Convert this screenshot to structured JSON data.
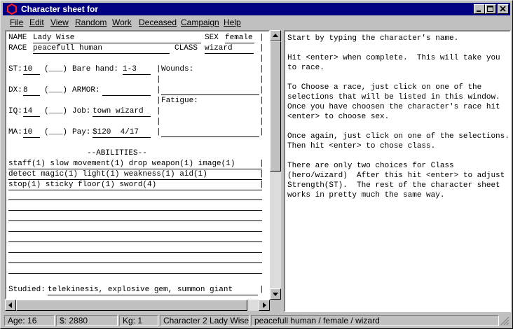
{
  "window": {
    "title": "Character sheet for"
  },
  "menu": [
    "File",
    "Edit",
    "View",
    "Random",
    "Work",
    "Deceased",
    "Campaign",
    "Help"
  ],
  "sheet": {
    "name_label": "NAME",
    "name_value": "Lady Wise",
    "sex_label": "SEX",
    "sex_value": "female",
    "race_label": "RACE",
    "race_value": "peacefull human",
    "class_label": "CLASS",
    "class_value": "wizard",
    "st_label": "ST:",
    "st_value": "10",
    "dx_label": "DX:",
    "dx_value": "8",
    "iq_label": "IQ:",
    "iq_value": "14",
    "ma_label": "MA:",
    "ma_value": "10",
    "bare_hand_label": "Bare hand:",
    "bare_hand_value": "1-3",
    "armor_label": "ARMOR:",
    "armor_value": "",
    "job_label": "Job:",
    "job_value": "town wizard",
    "pay_label": "Pay:",
    "pay_value": "$120  4/17",
    "wounds_label": "Wounds:",
    "fatigue_label": "Fatigue:",
    "abilities_header": "--ABILITIES--",
    "abilities": [
      "staff(1) slow movement(1) drop weapon(1) image(1)",
      "detect magic(1) light(1) weakness(1) aid(1)",
      "stop(1) sticky floor(1) sword(4)"
    ],
    "studied_label": "Studied:",
    "studied_value": "telekinesis, explosive gem, summon giant"
  },
  "help_text": "Start by typing the character's name.\n\nHit <enter> when complete.  This will take you to race.\n\nTo Choose a race, just click on one of the selections that will be listed in this window.  Once you have choosen the character's race hit <enter> to choose sex.\n\nOnce again, just click on one of the selections.  Then hit <enter> to chose class.\n\nThere are only two choices for Class (hero/wizard)  After this hit <enter> to adjust Strength(ST).  The rest of the character sheet works in pretty much the same way.",
  "status": {
    "age": "Age:  16",
    "money": "$: 2880",
    "kg": "Kg: 1",
    "character": "Character 2 Lady Wise",
    "summary": "peacefull human / female / wizard"
  },
  "colors": {
    "title_bar": "#000080",
    "face": "#c0c0c0",
    "icon": "#cc0000"
  }
}
